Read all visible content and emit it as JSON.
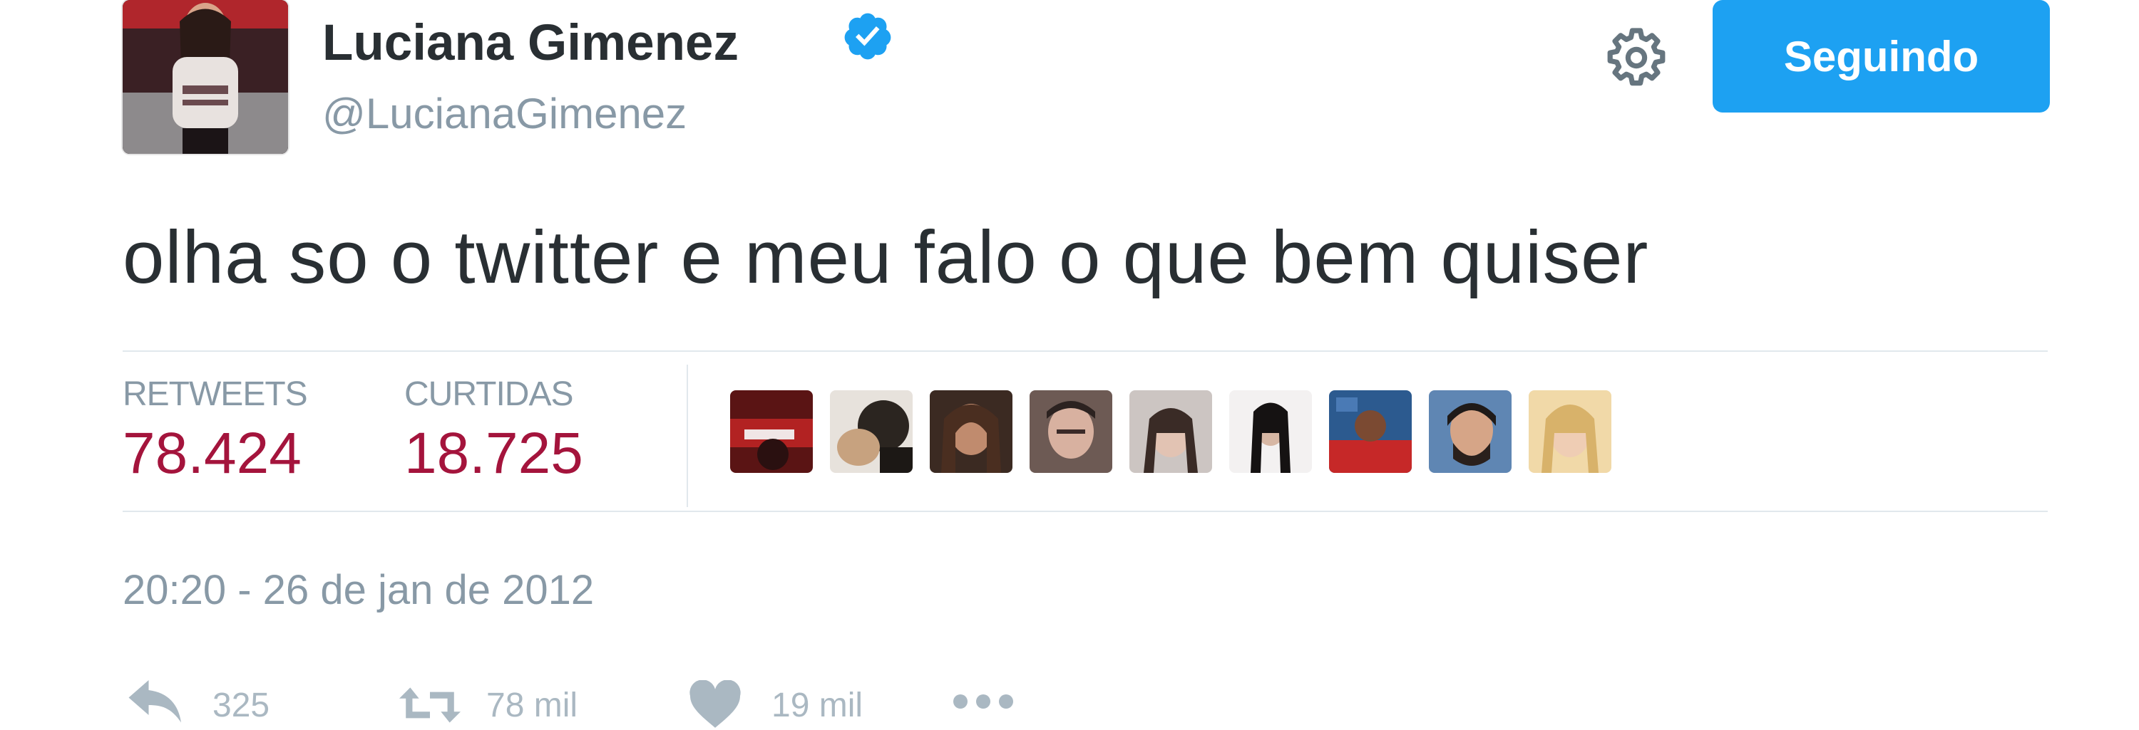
{
  "header": {
    "display_name": "Luciana Gimenez",
    "handle": "@LucianaGimenez",
    "verified_icon": "verified-badge-icon",
    "settings_icon": "gear-icon",
    "follow_button_label": "Seguindo",
    "accent_color": "#1da1f2"
  },
  "tweet": {
    "text": "olha so o twitter e meu falo o que bem quiser",
    "timestamp": "20:20 - 26 de jan de 2012"
  },
  "stats": {
    "retweets_label": "RETWEETS",
    "retweets_value": "78.424",
    "likes_label": "CURTIDAS",
    "likes_value": "18.725",
    "value_color": "#a4143c"
  },
  "likers": [
    {
      "icon": "liker-avatar-1"
    },
    {
      "icon": "liker-avatar-2"
    },
    {
      "icon": "liker-avatar-3"
    },
    {
      "icon": "liker-avatar-4"
    },
    {
      "icon": "liker-avatar-5"
    },
    {
      "icon": "liker-avatar-6"
    },
    {
      "icon": "liker-avatar-7"
    },
    {
      "icon": "liker-avatar-8"
    },
    {
      "icon": "liker-avatar-9"
    }
  ],
  "actions": {
    "reply_icon": "reply-icon",
    "reply_count": "325",
    "retweet_icon": "retweet-icon",
    "retweet_count": "78 mil",
    "like_icon": "heart-icon",
    "like_count": "19 mil",
    "more_icon": "more-dots-icon"
  }
}
